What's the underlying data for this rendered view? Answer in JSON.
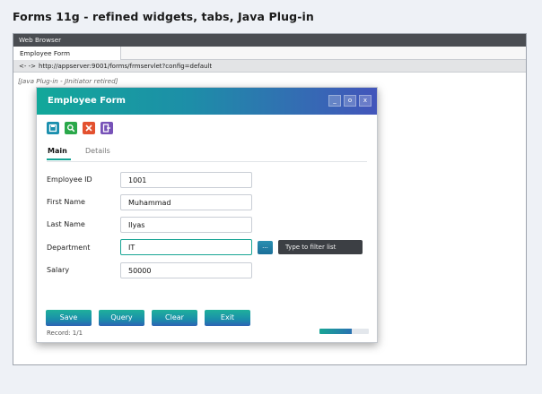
{
  "page": {
    "title": "Forms 11g - refined widgets, tabs, Java Plug-in"
  },
  "browser": {
    "title": "Web Browser",
    "tab_label": "Employee Form",
    "nav_arrows": "<- ->",
    "url": "http://appserver:9001/forms/frmservlet?config=default",
    "plugin_note": "[Java Plug-in - JInitiator retired]"
  },
  "form": {
    "title": "Employee Form",
    "window_buttons": [
      "_",
      "o",
      "x"
    ],
    "toolbar": [
      {
        "icon": "save-icon",
        "color": "#1a8fae"
      },
      {
        "icon": "search-icon",
        "color": "#2aa84a"
      },
      {
        "icon": "delete-icon",
        "color": "#e3512f"
      },
      {
        "icon": "exit-icon",
        "color": "#7752b8"
      }
    ],
    "tabs": [
      "Main",
      "Details"
    ],
    "fields": [
      {
        "label": "Employee ID",
        "value": "1001"
      },
      {
        "label": "First Name",
        "value": "Muhammad"
      },
      {
        "label": "Last Name",
        "value": "Ilyas"
      },
      {
        "label": "Department",
        "value": "IT"
      },
      {
        "label": "Salary",
        "value": "50000"
      }
    ],
    "lov_button": "...",
    "tooltip": "Type to filter list",
    "buttons": [
      "Save",
      "Query",
      "Clear",
      "Exit"
    ],
    "record": "Record: 1/1",
    "progress": 0.65
  },
  "colors": {
    "accent": "#14a394",
    "brand_end": "#4355bb",
    "tooltip_bg": "#3c3f44"
  }
}
